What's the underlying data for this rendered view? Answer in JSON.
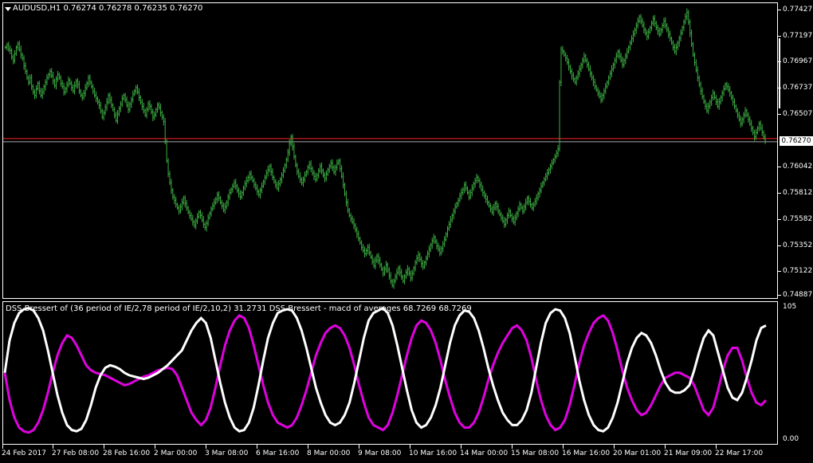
{
  "window": {
    "symbol_header": "AUDUSD,H1  0.76274 0.76278 0.76235 0.76270",
    "indicator_header": "DSS Bressert of  (36 period of IE/2,78 period of IE/2,10,2) 31.2731  DSS Bressert - macd of averages 68.7269 68.7269",
    "current_price": "0.76270"
  },
  "colors": {
    "background": "#000000",
    "candles": "#3cb043",
    "dss_line": "#ffffff",
    "signal_line": "#e000e0",
    "bid_line": "#ff2020",
    "ask_line": "#aaaaaa"
  },
  "price_axis": [
    "0.77427",
    "0.77197",
    "0.76967",
    "0.76737",
    "0.76507",
    "0.76042",
    "0.75812",
    "0.75582",
    "0.75352",
    "0.75122",
    "0.74887"
  ],
  "indicator_axis": [
    "105",
    "0.00"
  ],
  "time_axis": [
    "24 Feb 2017",
    "27 Feb 08:00",
    "28 Feb 16:00",
    "2 Mar 00:00",
    "3 Mar 08:00",
    "6 Mar 16:00",
    "8 Mar 00:00",
    "9 Mar 08:00",
    "10 Mar 16:00",
    "14 Mar 00:00",
    "15 Mar 08:00",
    "16 Mar 16:00",
    "20 Mar 01:00",
    "21 Mar 09:00",
    "22 Mar 17:00"
  ],
  "chart_data": [
    {
      "type": "line",
      "series": [
        {
          "values": [
            0.7712,
            0.7714,
            0.771,
            0.7709,
            0.7703,
            0.77,
            0.7706,
            0.7712,
            0.7715,
            0.771,
            0.7705,
            0.7702,
            0.7695,
            0.769,
            0.7684,
            0.768,
            0.7684,
            0.7676,
            0.7671,
            0.7668,
            0.7674,
            0.7679,
            0.7672,
            0.7668,
            0.7671,
            0.7676,
            0.768,
            0.7684,
            0.7687,
            0.769,
            0.7686,
            0.7681,
            0.7677,
            0.7683,
            0.7687,
            0.7684,
            0.7679,
            0.7676,
            0.7671,
            0.7674,
            0.7678,
            0.7682,
            0.7679,
            0.7675,
            0.7672,
            0.7677,
            0.7681,
            0.7678,
            0.7672,
            0.7668,
            0.7666,
            0.767,
            0.7675,
            0.7679,
            0.7684,
            0.768,
            0.7676,
            0.7672,
            0.7668,
            0.7665,
            0.7662,
            0.7659,
            0.7654,
            0.7648,
            0.7652,
            0.7657,
            0.7662,
            0.7668,
            0.7664,
            0.7659,
            0.7655,
            0.765,
            0.7645,
            0.7651,
            0.7656,
            0.766,
            0.7665,
            0.7668,
            0.7664,
            0.7659,
            0.7655,
            0.766,
            0.7664,
            0.7669,
            0.7672,
            0.7675,
            0.7671,
            0.7666,
            0.7662,
            0.7658,
            0.7654,
            0.765,
            0.7655,
            0.766,
            0.7658,
            0.7653,
            0.7648,
            0.765,
            0.7655,
            0.7659,
            0.7657,
            0.7652,
            0.7648,
            0.7644,
            0.7626,
            0.7608,
            0.7596,
            0.7588,
            0.7581,
            0.7575,
            0.7572,
            0.7568,
            0.7565,
            0.7562,
            0.7566,
            0.757,
            0.7574,
            0.7569,
            0.7565,
            0.7561,
            0.7558,
            0.7555,
            0.7552,
            0.7549,
            0.7553,
            0.7557,
            0.7561,
            0.7558,
            0.7554,
            0.755,
            0.7547,
            0.7551,
            0.7556,
            0.756,
            0.7564,
            0.7567,
            0.757,
            0.7573,
            0.7577,
            0.7574,
            0.757,
            0.7567,
            0.7563,
            0.7566,
            0.757,
            0.7575,
            0.7579,
            0.7582,
            0.7585,
            0.7588,
            0.7585,
            0.7581,
            0.7578,
            0.7575,
            0.7579,
            0.7583,
            0.7587,
            0.759,
            0.7593,
            0.7596,
            0.7593,
            0.759,
            0.7586,
            0.7583,
            0.758,
            0.7577,
            0.7581,
            0.7585,
            0.7589,
            0.7593,
            0.7597,
            0.76,
            0.7603,
            0.7598,
            0.7593,
            0.7589,
            0.7586,
            0.7583,
            0.7587,
            0.7591,
            0.7595,
            0.7599,
            0.7604,
            0.7609,
            0.7616,
            0.7624,
            0.763,
            0.7621,
            0.7612,
            0.7604,
            0.7598,
            0.7594,
            0.7591,
            0.7588,
            0.7591,
            0.7595,
            0.7598,
            0.7602,
            0.7605,
            0.7601,
            0.7597,
            0.7594,
            0.7591,
            0.7595,
            0.7599,
            0.7603,
            0.7599,
            0.7595,
            0.7592,
            0.7596,
            0.76,
            0.7603,
            0.7606,
            0.7602,
            0.7598,
            0.7602,
            0.7606,
            0.7608,
            0.7601,
            0.7594,
            0.7586,
            0.7578,
            0.757,
            0.7563,
            0.7558,
            0.7555,
            0.7552,
            0.7549,
            0.7545,
            0.7541,
            0.7537,
            0.7533,
            0.7529,
            0.7526,
            0.7523,
            0.7526,
            0.7529,
            0.7524,
            0.752,
            0.7516,
            0.7512,
            0.7517,
            0.7521,
            0.7517,
            0.7513,
            0.7509,
            0.7505,
            0.7509,
            0.7513,
            0.7508,
            0.7503,
            0.7498,
            0.7494,
            0.7498,
            0.7502,
            0.7506,
            0.751,
            0.7506,
            0.7502,
            0.7498,
            0.7502,
            0.7506,
            0.7509,
            0.7505,
            0.7501,
            0.7505,
            0.751,
            0.7515,
            0.7519,
            0.7522,
            0.7518,
            0.7514,
            0.7511,
            0.7515,
            0.7519,
            0.7523,
            0.7527,
            0.7531,
            0.7535,
            0.7538,
            0.7534,
            0.753,
            0.7527,
            0.7524,
            0.7528,
            0.7532,
            0.7536,
            0.7541,
            0.7546,
            0.755,
            0.7554,
            0.7558,
            0.7562,
            0.7566,
            0.7569,
            0.7572,
            0.7576,
            0.7579,
            0.7582,
            0.7586,
            0.7583,
            0.7579,
            0.7575,
            0.7579,
            0.7583,
            0.7587,
            0.759,
            0.7593,
            0.759,
            0.7586,
            0.7582,
            0.7579,
            0.7576,
            0.7573,
            0.757,
            0.7567,
            0.7564,
            0.7561,
            0.7565,
            0.7569,
            0.7566,
            0.7562,
            0.7559,
            0.7556,
            0.7553,
            0.755,
            0.7554,
            0.7558,
            0.7562,
            0.7558,
            0.7555,
            0.7552,
            0.7556,
            0.756,
            0.7564,
            0.7568,
            0.7565,
            0.7562,
            0.7566,
            0.757,
            0.7574,
            0.7571,
            0.7568,
            0.7565,
            0.7568,
            0.7571,
            0.7574,
            0.7578,
            0.7581,
            0.7585,
            0.7588,
            0.7591,
            0.7594,
            0.7597,
            0.76,
            0.7603,
            0.7606,
            0.7609,
            0.7612,
            0.7615,
            0.7619,
            0.768,
            0.771,
            0.7708,
            0.7705,
            0.7702,
            0.7698,
            0.7694,
            0.769,
            0.7686,
            0.7683,
            0.768,
            0.7684,
            0.7688,
            0.7692,
            0.7696,
            0.77,
            0.7704,
            0.77,
            0.7696,
            0.7692,
            0.7688,
            0.7684,
            0.768,
            0.7676,
            0.7673,
            0.767,
            0.7667,
            0.7664,
            0.7668,
            0.7672,
            0.7676,
            0.768,
            0.7684,
            0.7688,
            0.7692,
            0.7696,
            0.77,
            0.7704,
            0.7708,
            0.7704,
            0.77,
            0.7696,
            0.77,
            0.7704,
            0.7708,
            0.7712,
            0.7716,
            0.772,
            0.7724,
            0.7728,
            0.7732,
            0.7736,
            0.774,
            0.7736,
            0.7732,
            0.7728,
            0.7725,
            0.7722,
            0.7726,
            0.773,
            0.7734,
            0.7738,
            0.7734,
            0.773,
            0.7727,
            0.7724,
            0.7728,
            0.7732,
            0.7736,
            0.7732,
            0.7728,
            0.7724,
            0.772,
            0.7716,
            0.7712,
            0.7708,
            0.7712,
            0.7716,
            0.772,
            0.7725,
            0.773,
            0.7735,
            0.774,
            0.7744,
            0.7735,
            0.7725,
            0.7715,
            0.7705,
            0.7698,
            0.7691,
            0.7684,
            0.7678,
            0.7672,
            0.7667,
            0.7662,
            0.7658,
            0.7654,
            0.7658,
            0.7662,
            0.7666,
            0.767,
            0.7666,
            0.7662,
            0.7658,
            0.7662,
            0.7666,
            0.767,
            0.7674,
            0.7678,
            0.7676,
            0.7673,
            0.767,
            0.7666,
            0.7662,
            0.7658,
            0.7654,
            0.765,
            0.7646,
            0.7642,
            0.7646,
            0.765,
            0.7654,
            0.765,
            0.7646,
            0.7642,
            0.7638,
            0.7634,
            0.763,
            0.7634,
            0.7638,
            0.7642,
            0.7638,
            0.7634,
            0.763,
            0.7627
          ]
        }
      ]
    },
    {
      "type": "line",
      "ylim": [
        0,
        105
      ],
      "x_count": 160,
      "series": [
        {
          "values": [
            52,
            78,
            92,
            100,
            103,
            104,
            102,
            96,
            86,
            70,
            52,
            34,
            20,
            10,
            6,
            5,
            7,
            14,
            26,
            40,
            50,
            56,
            58,
            57,
            55,
            52,
            50,
            49,
            48,
            47,
            48,
            50,
            52,
            55,
            58,
            62,
            66,
            70,
            78,
            86,
            92,
            96,
            92,
            80,
            62,
            44,
            28,
            16,
            8,
            5,
            6,
            12,
            24,
            42,
            62,
            80,
            92,
            100,
            102,
            103,
            102,
            96,
            86,
            72,
            56,
            40,
            28,
            18,
            12,
            10,
            12,
            18,
            28,
            44,
            62,
            80,
            94,
            100,
            102,
            104,
            100,
            90,
            74,
            56,
            38,
            22,
            12,
            8,
            10,
            16,
            26,
            40,
            58,
            76,
            90,
            98,
            102,
            101,
            96,
            86,
            72,
            56,
            42,
            30,
            20,
            14,
            10,
            10,
            14,
            22,
            36,
            56,
            76,
            92,
            100,
            103,
            102,
            96,
            84,
            66,
            46,
            30,
            18,
            10,
            6,
            5,
            8,
            16,
            28,
            44,
            60,
            72,
            80,
            84,
            82,
            76,
            66,
            54,
            44,
            38,
            36,
            36,
            38,
            42,
            54,
            68,
            80,
            86,
            82,
            68,
            54,
            40,
            32,
            30,
            36,
            48,
            62,
            78,
            88,
            90
          ]
        },
        {
          "values": [
            52,
            30,
            16,
            8,
            5,
            4,
            6,
            12,
            22,
            36,
            52,
            66,
            76,
            82,
            80,
            74,
            66,
            58,
            54,
            52,
            51,
            50,
            48,
            46,
            44,
            42,
            43,
            45,
            47,
            49,
            50,
            52,
            54,
            55,
            56,
            55,
            50,
            40,
            30,
            20,
            14,
            10,
            14,
            24,
            40,
            58,
            74,
            86,
            94,
            98,
            96,
            88,
            74,
            58,
            42,
            28,
            18,
            12,
            10,
            8,
            10,
            16,
            26,
            38,
            52,
            66,
            76,
            84,
            88,
            90,
            88,
            82,
            72,
            58,
            42,
            28,
            16,
            10,
            8,
            6,
            10,
            20,
            34,
            50,
            66,
            80,
            90,
            94,
            92,
            86,
            76,
            62,
            46,
            32,
            20,
            12,
            8,
            8,
            12,
            20,
            32,
            46,
            58,
            68,
            76,
            82,
            88,
            90,
            86,
            78,
            64,
            46,
            30,
            18,
            10,
            6,
            8,
            14,
            26,
            42,
            60,
            74,
            84,
            92,
            96,
            98,
            94,
            84,
            70,
            54,
            40,
            30,
            22,
            18,
            20,
            26,
            34,
            42,
            48,
            50,
            52,
            52,
            50,
            48,
            42,
            32,
            22,
            18,
            24,
            38,
            54,
            66,
            72,
            72,
            62,
            48,
            36,
            28,
            26,
            30
          ]
        }
      ]
    }
  ]
}
